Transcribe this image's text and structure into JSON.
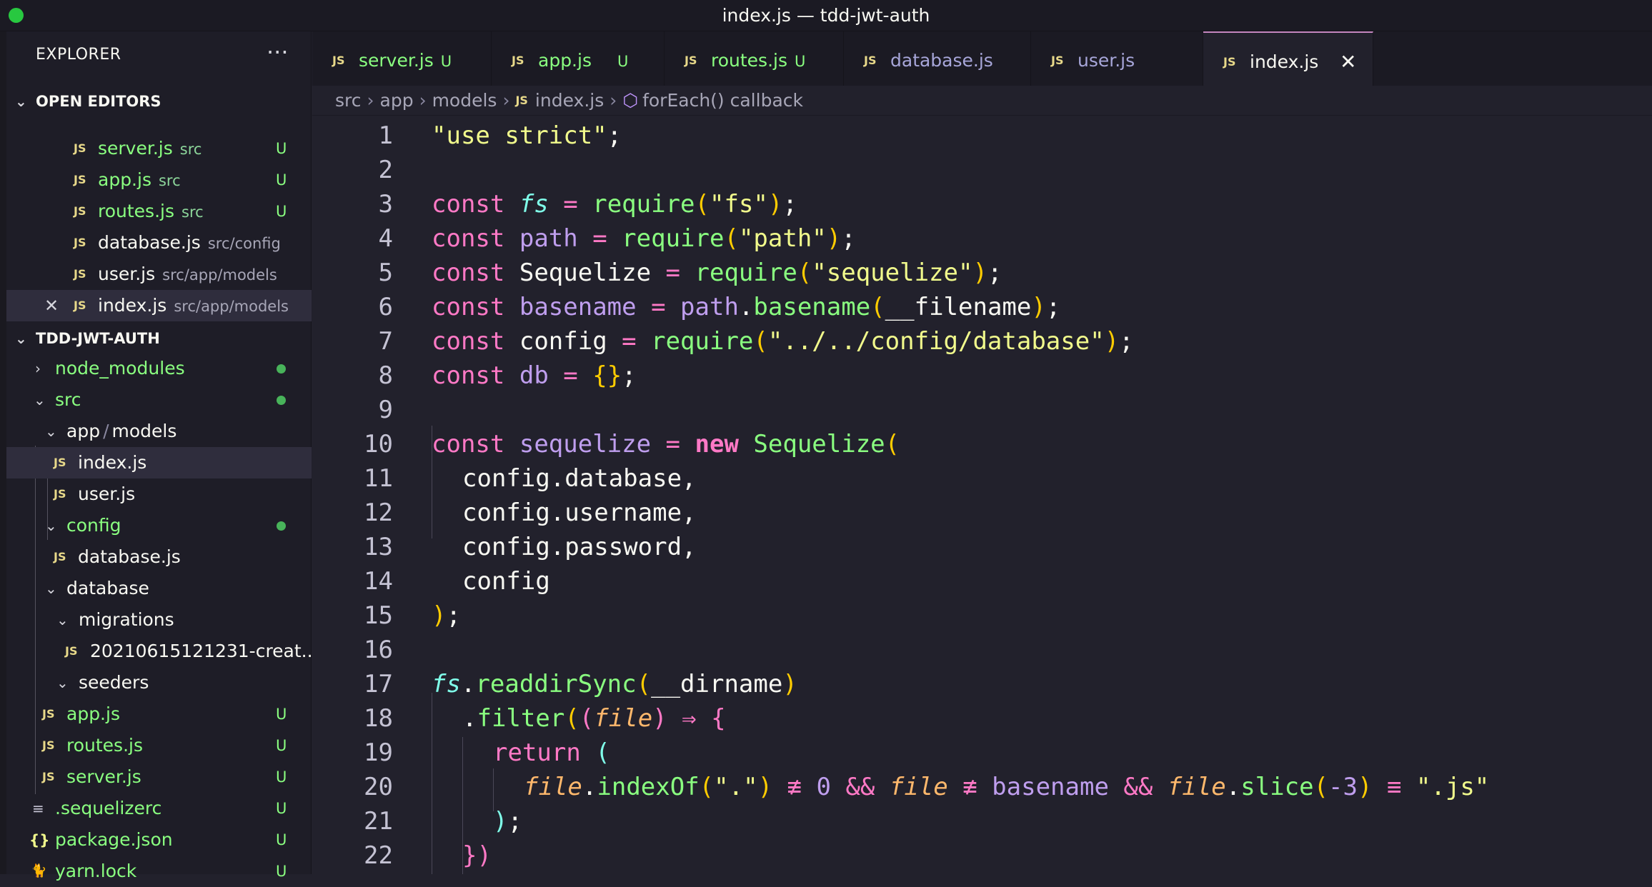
{
  "window": {
    "title": "index.js — tdd-jwt-auth"
  },
  "sidebar": {
    "title": "EXPLORER",
    "more": "···",
    "open_editors": {
      "label": "OPEN EDITORS",
      "items": [
        {
          "icon": "JS",
          "name": "server.js",
          "path": "src",
          "badge": "U"
        },
        {
          "icon": "JS",
          "name": "app.js",
          "path": "src",
          "badge": "U"
        },
        {
          "icon": "JS",
          "name": "routes.js",
          "path": "src",
          "badge": "U"
        },
        {
          "icon": "JS",
          "name": "database.js",
          "path": "src/config",
          "badge": ""
        },
        {
          "icon": "JS",
          "name": "user.js",
          "path": "src/app/models",
          "badge": ""
        },
        {
          "icon": "JS",
          "name": "index.js",
          "path": "src/app/models",
          "badge": "",
          "close": "✕"
        }
      ]
    },
    "project": {
      "label": "TDD-JWT-AUTH",
      "items": [
        {
          "name": "node_modules"
        },
        {
          "name": "src"
        },
        {
          "name": "app",
          "sep": "/",
          "name2": "models"
        },
        {
          "icon": "JS",
          "name": "index.js"
        },
        {
          "icon": "JS",
          "name": "user.js"
        },
        {
          "name": "config"
        },
        {
          "icon": "JS",
          "name": "database.js"
        },
        {
          "name": "database"
        },
        {
          "name": "migrations"
        },
        {
          "icon": "JS",
          "name": "20210615121231-creat..."
        },
        {
          "name": "seeders"
        },
        {
          "icon": "JS",
          "name": "app.js",
          "badge": "U"
        },
        {
          "icon": "JS",
          "name": "routes.js",
          "badge": "U"
        },
        {
          "icon": "JS",
          "name": "server.js",
          "badge": "U"
        },
        {
          "icon": "≡",
          "name": ".sequelizerc",
          "badge": "U"
        },
        {
          "icon": "{}",
          "name": "package.json",
          "badge": "U"
        },
        {
          "icon": "🐈",
          "name": "yarn.lock",
          "badge": "U"
        }
      ]
    }
  },
  "tabs": [
    {
      "icon": "JS",
      "name": "server.js",
      "badge": "U"
    },
    {
      "icon": "JS",
      "name": "app.js",
      "badge": "U"
    },
    {
      "icon": "JS",
      "name": "routes.js",
      "badge": "U"
    },
    {
      "icon": "JS",
      "name": "database.js",
      "badge": ""
    },
    {
      "icon": "JS",
      "name": "user.js",
      "badge": ""
    },
    {
      "icon": "JS",
      "name": "index.js",
      "badge": "",
      "close": "✕"
    }
  ],
  "breadcrumb": {
    "parts": [
      "src",
      "app",
      "models"
    ],
    "sep": "›",
    "file_icon": "JS",
    "file": "index.js",
    "symbol_icon": "⬡",
    "symbol": "forEach() callback"
  },
  "editor": {
    "line_numbers": [
      "1",
      "2",
      "3",
      "4",
      "5",
      "6",
      "7",
      "8",
      "9",
      "10",
      "11",
      "12",
      "13",
      "14",
      "15",
      "16",
      "17",
      "18",
      "19",
      "20",
      "21",
      "22"
    ],
    "tokens": {
      "use_strict": "\"use strict\"",
      "semi": ";",
      "const": "const",
      "eq": " = ",
      "require": "require",
      "lp": "(",
      "rp": ")",
      "fs": "fs",
      "s_fs": "\"fs\"",
      "path": "path",
      "s_path": "\"path\"",
      "Sequelize": "Sequelize",
      "s_sequelize": "\"sequelize\"",
      "basename": "basename",
      "dot": ".",
      "filename": "__filename",
      "config": "config",
      "s_config": "\"../../config/database\"",
      "db": "db",
      "obj": "{}",
      "sequelize": "sequelize",
      "new": "new",
      "l11": "config.database,",
      "l12": "config.username,",
      "l13": "config.password,",
      "l14": "config",
      "l15_close": ")",
      "readdirSync": "readdirSync",
      "dirname": "__dirname",
      "filter": "filter",
      "file": "file",
      "arrow": " ⇒ ",
      "lbrace": "{",
      "return": "return",
      "indexOf": "indexOf",
      "s_dot": "\".\"",
      "neq": " ≢ ",
      "zero": "0",
      "and": " && ",
      "slice": "slice",
      "minus3": "-3",
      "eqeq": " ≡ ",
      "s_js": "\".js\"",
      "l22_close": "})"
    }
  }
}
